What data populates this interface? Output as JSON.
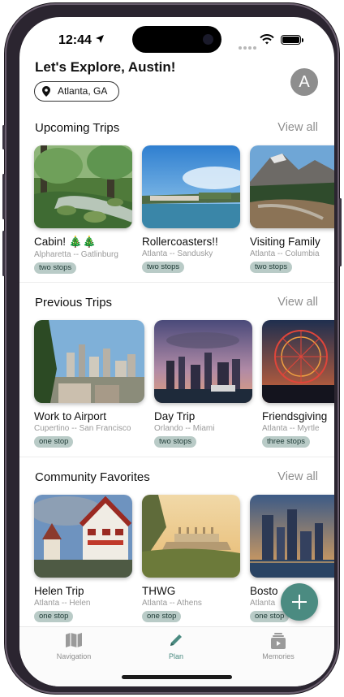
{
  "status_bar": {
    "time": "12:44"
  },
  "header": {
    "greeting": "Let's Explore, Austin!",
    "location": "Atlanta, GA",
    "avatar_initial": "A"
  },
  "sections": [
    {
      "title": "Upcoming Trips",
      "view_all": "View all",
      "cards": [
        {
          "title": "Cabin! 🎄🎄",
          "route": "Alpharetta -- Gatlinburg",
          "stops": "two stops"
        },
        {
          "title": "Rollercoasters!!",
          "route": "Atlanta -- Sandusky",
          "stops": "two stops"
        },
        {
          "title": "Visiting Family",
          "route": "Atlanta -- Columbia",
          "stops": "two stops"
        }
      ]
    },
    {
      "title": "Previous Trips",
      "view_all": "View all",
      "cards": [
        {
          "title": "Work to Airport",
          "route": "Cupertino -- San Francisco",
          "stops": "one stop"
        },
        {
          "title": "Day Trip",
          "route": "Orlando -- Miami",
          "stops": "two stops"
        },
        {
          "title": "Friendsgiving",
          "route": "Atlanta -- Myrtle",
          "stops": "three stops"
        }
      ]
    },
    {
      "title": "Community Favorites",
      "view_all": "View all",
      "cards": [
        {
          "title": "Helen Trip",
          "route": "Atlanta -- Helen",
          "stops": "one stop"
        },
        {
          "title": "THWG",
          "route": "Atlanta -- Athens",
          "stops": "one stop"
        },
        {
          "title": "Bosto",
          "route": "Atlanta",
          "stops": "one stop"
        }
      ]
    }
  ],
  "tabs": [
    {
      "label": "Navigation",
      "icon": "map-icon"
    },
    {
      "label": "Plan",
      "icon": "pencil-icon"
    },
    {
      "label": "Memories",
      "icon": "photo-stack-icon"
    }
  ],
  "colors": {
    "accent": "#4b8b81",
    "pill": "#b9cbc7"
  }
}
